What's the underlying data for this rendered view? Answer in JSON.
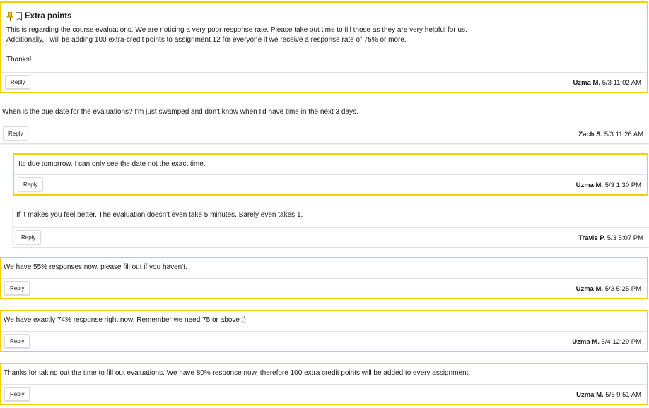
{
  "colors": {
    "highlight": "#f5d000",
    "pin": "#f5c800"
  },
  "first_post": {
    "title": "Extra points",
    "icons": [
      "pin-icon",
      "bookmark-icon"
    ],
    "body": "This is regarding the course evaluations. We are noticing a very poor response rate. Please take out time to fill those as they are very helpful for us.\nAdditionally, I will be adding 100 extra-credit points to assignment 12 for everyone if we receive a response rate of 75% or more.\n\nThanks!",
    "reply_label": "Reply",
    "author": "Uzma M.",
    "timestamp": "5/3 11:02 AM"
  },
  "replies": [
    {
      "body": "When is the due date for the evaluations? I'm just swamped and don't know when I'd have time in the next 3 days.",
      "reply_label": "Reply",
      "author": "Zach S.",
      "timestamp": "5/3 11:26 AM"
    },
    {
      "body": "Its due tomorrow. I can only see the date not the exact time.",
      "reply_label": "Reply",
      "author": "Uzma M.",
      "timestamp": "5/3 1:30 PM"
    },
    {
      "body": "If it makes you feel better. The evaluation doesn't even take 5 minutes. Barely even takes 1.",
      "reply_label": "Reply",
      "author": "Travis P.",
      "timestamp": "5/3 5:07 PM"
    },
    {
      "body": "We have 55% responses now, please fill out if you haven't.",
      "reply_label": "Reply",
      "author": "Uzma M.",
      "timestamp": "5/3 5:25 PM"
    },
    {
      "body": "We have exactly 74% response right now. Remember we need 75 or above :)",
      "reply_label": "Reply",
      "author": "Uzma M.",
      "timestamp": "5/4 12:29 PM"
    },
    {
      "body": "Thanks for taking out the time to fill out evaluations. We have 80% response now, therefore 100 extra credit points will be added to every assignment.",
      "reply_label": "Reply",
      "author": "Uzma M.",
      "timestamp": "5/5 9:51 AM"
    }
  ]
}
